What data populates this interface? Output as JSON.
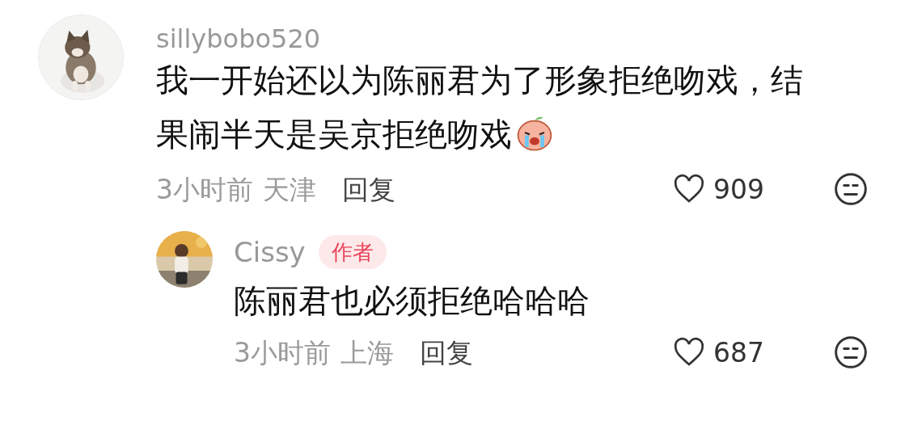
{
  "comments": [
    {
      "username": "sillybobo520",
      "text": "我一开始还以为陈丽君为了形象拒绝吻戏，结果闹半天是吴京拒绝吻戏",
      "time": "3小时前",
      "location": "天津",
      "reply_label": "回复",
      "likes": "909",
      "liked": false,
      "replies": [
        {
          "username": "Cissy",
          "badge": "作者",
          "text": "陈丽君也必须拒绝哈哈哈",
          "time": "3小时前",
          "location": "上海",
          "reply_label": "回复",
          "likes": "687",
          "liked": false
        }
      ]
    }
  ]
}
